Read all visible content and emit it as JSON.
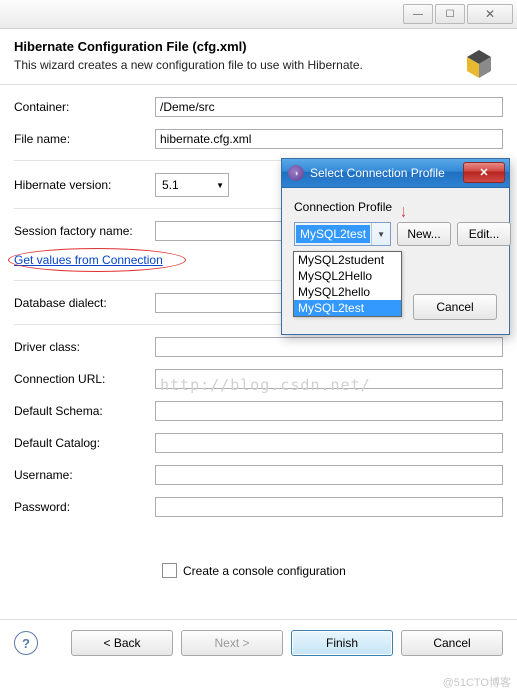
{
  "titlebar": {
    "min": "—",
    "max": "☐",
    "close": "✕"
  },
  "header": {
    "title": "Hibernate Configuration File (cfg.xml)",
    "desc": "This wizard creates a new configuration file to use with Hibernate."
  },
  "form": {
    "container_label": "Container:",
    "container_value": "/Deme/src",
    "filename_label": "File name:",
    "filename_value": "hibernate.cfg.xml",
    "hversion_label": "Hibernate version:",
    "hversion_value": "5.1",
    "session_label": "Session factory name:",
    "session_value": "",
    "link_text": "Get values from Connection",
    "dialect_label": "Database dialect:",
    "dialect_value": "",
    "driver_label": "Driver class:",
    "driver_value": "",
    "url_label": "Connection URL:",
    "url_value": "",
    "schema_label": "Default Schema:",
    "schema_value": "",
    "catalog_label": "Default Catalog:",
    "catalog_value": "",
    "username_label": "Username:",
    "username_value": "",
    "password_label": "Password:",
    "password_value": "",
    "console_label": "Create a console configuration"
  },
  "buttons": {
    "back": "< Back",
    "next": "Next >",
    "finish": "Finish",
    "cancel": "Cancel"
  },
  "popup": {
    "title": "Select Connection Profile",
    "body_label": "Connection Profile",
    "combo_selected": "MySQL2test",
    "new_btn": "New...",
    "edit_btn": "Edit...",
    "cancel_btn": "Cancel",
    "options": [
      "MySQL2student",
      "MySQL2Hello",
      "MySQL2hello",
      "MySQL2test"
    ]
  },
  "watermark": "http://blog.csdn.net/",
  "attrib": "@51CTO博客",
  "help": "?",
  "carets": {
    "down": "▼"
  }
}
